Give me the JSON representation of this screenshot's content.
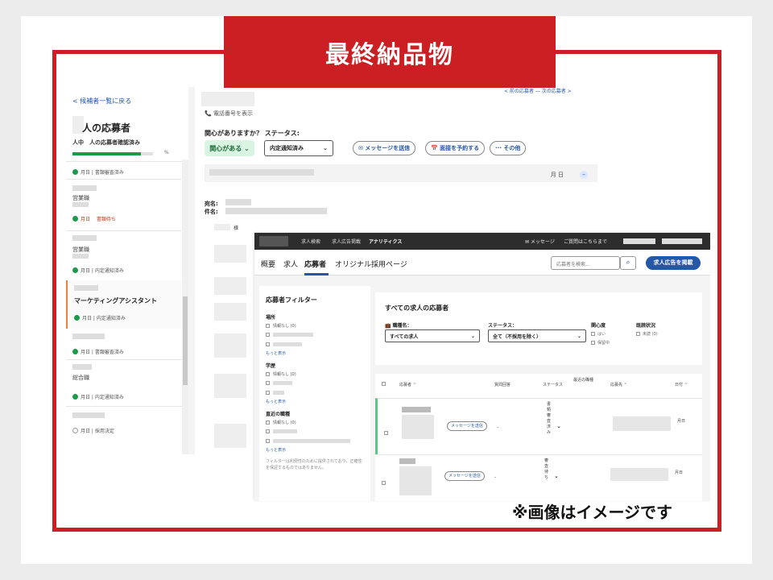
{
  "banner_title": "最終納品物",
  "caption": "※画像はイメージです",
  "colors": {
    "brand_red": "#cc1f24",
    "accent_blue": "#2557a7",
    "success_green": "#1b9a48"
  },
  "back": {
    "back_link": "< 候補者一覧に戻る",
    "panel_title": "人の応募者",
    "panel_sub": "人中　人の応募者確認済み",
    "progress_fraction": 0.85,
    "progress_pct": "%",
    "items": [
      {
        "role": "",
        "status": "月日 | 書類審査済み"
      },
      {
        "role": "営業職",
        "status": "月日 　書類待ち"
      },
      {
        "role": "営業職",
        "status": "月日 | 内定通知済み"
      },
      {
        "role": "マーケティングアシスタント",
        "status": "月日 | 内定通知済み"
      },
      {
        "role": "",
        "status": "月日 | 書類審査済み"
      },
      {
        "role": "総合職",
        "status": "月日 | 内定通知済み"
      },
      {
        "role": "",
        "status": "月日 | 採用決定"
      }
    ],
    "phone_link": "📞 電話番号を表示",
    "interest_question": "関心がありますか？ ステータス:",
    "interest_button": "関心がある ⌄",
    "status_select": "内定通知済み",
    "send_message": "✉ メッセージを送信",
    "schedule_interview": "📅 面接を予約する",
    "more_button": "··· その他",
    "nav_links": "< 前の応募者 ― 次の応募者 >",
    "date_chip": "月 日",
    "recipient_label": "宛名:",
    "subject_label": "件名:",
    "salutation": "様"
  },
  "front": {
    "topnav": [
      "求人検索",
      "求人広告掲載",
      "アナリティクス"
    ],
    "top_right": [
      "✉ メッセージ",
      "ご質問はこちらまで"
    ],
    "tabs": [
      "概要",
      "求人",
      "応募者",
      "オリジナル採用ページ"
    ],
    "search_placeholder": "応募者を検索...",
    "post_button": "求人広告を掲載",
    "filter": {
      "title": "応募者フィルター",
      "location_label": "場所",
      "location_none": "情報なし (0)",
      "more1": "もっと表示",
      "education_label": "学歴",
      "education_none": "情報なし (0)",
      "more2": "もっと表示",
      "recent_label": "直近の職種",
      "recent_none": "情報なし (0)",
      "more3": "もっと表示",
      "note": "フィルターは利便性のために提供されており、正確性を保証するものではありません。"
    },
    "top_panel": {
      "title": "すべての求人の応募者",
      "job_label": "💼 職種名：",
      "job_value": "すべての求人",
      "status_label": "ステータス：",
      "status_value": "全て（不採用を除く）",
      "interest_label": "関心度",
      "interest_yes": "はい",
      "interest_hold": "保留中",
      "viewed_label": "既読状況",
      "viewed_no": "未読 (0)"
    },
    "table": {
      "headers": [
        "応募者 ⌃",
        "質問回答",
        "ステータス",
        "最近の職種",
        "応募先 ⌃",
        "日付 ⌃"
      ],
      "rows": [
        {
          "action": "メッセージを送信",
          "answer": "-",
          "status": "書類審査済み",
          "date": "月日"
        },
        {
          "action": "メッセージを送信",
          "answer": "-",
          "status": "審査待ち",
          "date": "月日"
        }
      ]
    }
  }
}
